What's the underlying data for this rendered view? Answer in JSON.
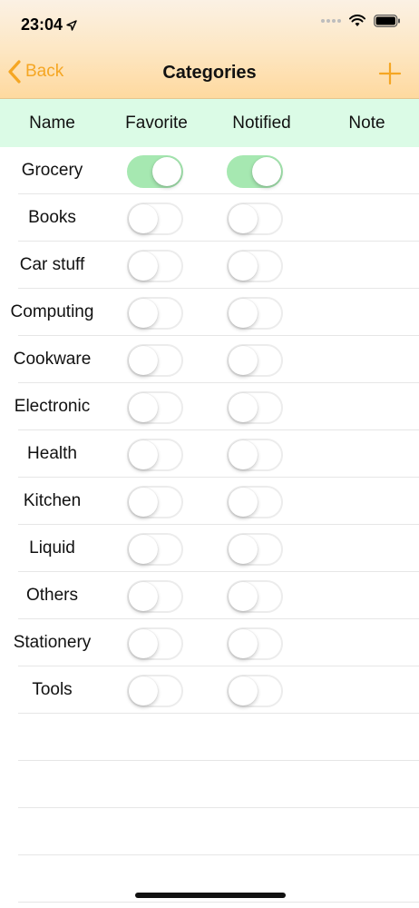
{
  "status": {
    "time": "23:04"
  },
  "nav": {
    "back_label": "Back",
    "title": "Categories"
  },
  "columns": {
    "name": "Name",
    "favorite": "Favorite",
    "notified": "Notified",
    "note": "Note"
  },
  "categories": [
    {
      "name": "Grocery",
      "favorite": true,
      "notified": true
    },
    {
      "name": "Books",
      "favorite": false,
      "notified": false
    },
    {
      "name": "Car stuff",
      "favorite": false,
      "notified": false
    },
    {
      "name": "Computing",
      "favorite": false,
      "notified": false
    },
    {
      "name": "Cookware",
      "favorite": false,
      "notified": false
    },
    {
      "name": "Electronic",
      "favorite": false,
      "notified": false
    },
    {
      "name": "Health",
      "favorite": false,
      "notified": false
    },
    {
      "name": "Kitchen",
      "favorite": false,
      "notified": false
    },
    {
      "name": "Liquid",
      "favorite": false,
      "notified": false
    },
    {
      "name": "Others",
      "favorite": false,
      "notified": false
    },
    {
      "name": "Stationery",
      "favorite": false,
      "notified": false
    },
    {
      "name": "Tools",
      "favorite": false,
      "notified": false
    }
  ],
  "colors": {
    "accent": "#f5a623",
    "header_bg": "#dbfbe6",
    "switch_on": "#a6e8b1"
  }
}
